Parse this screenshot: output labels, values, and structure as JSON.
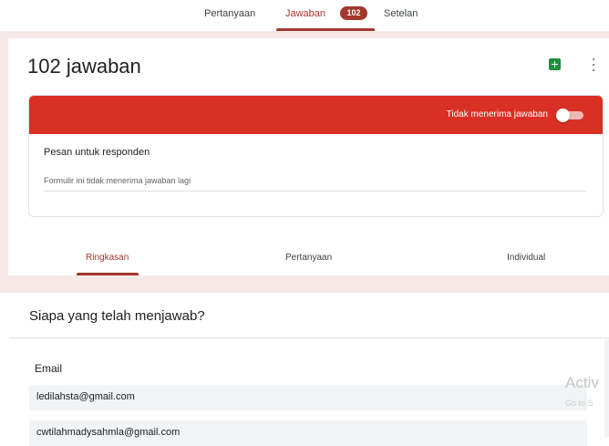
{
  "top_tabs": [
    {
      "label": "Pertanyaan"
    },
    {
      "label": "Jawaban"
    },
    {
      "label": "Setelan"
    }
  ],
  "responses_badge": "102",
  "responses_title": "102 jawaban",
  "accepting_toggle": {
    "label": "Tidak menerima jawaban",
    "on": false
  },
  "closed_message": {
    "label": "Pesan untuk responden",
    "text": "Formulir ini tidak menerima jawaban lagi"
  },
  "sub_tabs": [
    {
      "label": "Ringkasan"
    },
    {
      "label": "Pertanyaan"
    },
    {
      "label": "Individual"
    }
  ],
  "who_answered": {
    "title": "Siapa yang telah menjawab?",
    "email_label": "Email",
    "emails": [
      "ledilahsta@gmail.com",
      "cwtilahmadysahmla@gmail.com"
    ]
  },
  "watermark": {
    "title": "Activ",
    "subtitle": "Go to S"
  },
  "colors": {
    "accent": "#a3382c",
    "banner": "#d93025",
    "band": "#f5e9e8",
    "sheets": "#1e8e3e"
  },
  "icons": {
    "sheets": "sheets-icon",
    "more": "more-vert-icon"
  }
}
